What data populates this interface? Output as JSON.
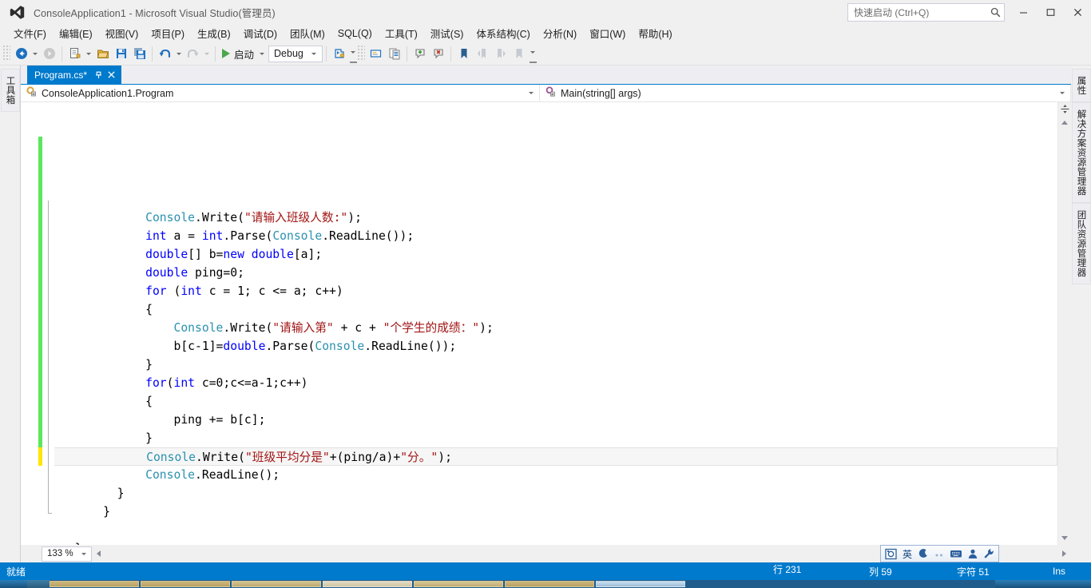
{
  "window": {
    "title": "ConsoleApplication1 - Microsoft Visual Studio(管理员)",
    "logo_icon": "visual-studio-logo-icon",
    "minimize_label": "─",
    "maximize_label": "☐",
    "close_label": "✕"
  },
  "quick_launch": {
    "placeholder": "快速启动 (Ctrl+Q)",
    "value": "",
    "icon": "search-icon"
  },
  "menubar": {
    "items": [
      {
        "text": "文件(F)",
        "name": "menu-file"
      },
      {
        "text": "编辑(E)",
        "name": "menu-edit"
      },
      {
        "text": "视图(V)",
        "name": "menu-view"
      },
      {
        "text": "项目(P)",
        "name": "menu-project"
      },
      {
        "text": "生成(B)",
        "name": "menu-build"
      },
      {
        "text": "调试(D)",
        "name": "menu-debug"
      },
      {
        "text": "团队(M)",
        "name": "menu-team"
      },
      {
        "text": "SQL(Q)",
        "name": "menu-sql"
      },
      {
        "text": "工具(T)",
        "name": "menu-tools"
      },
      {
        "text": "测试(S)",
        "name": "menu-test"
      },
      {
        "text": "体系结构(C)",
        "name": "menu-architecture"
      },
      {
        "text": "分析(N)",
        "name": "menu-analyze"
      },
      {
        "text": "窗口(W)",
        "name": "menu-window"
      },
      {
        "text": "帮助(H)",
        "name": "menu-help"
      }
    ]
  },
  "toolbar": {
    "start_label": "启动",
    "config_value": "Debug",
    "icons": [
      "navigate-backward-icon",
      "navigate-forward-icon",
      "new-project-icon",
      "open-file-icon",
      "save-icon",
      "save-all-icon",
      "undo-icon",
      "redo-icon",
      "start-debug-icon",
      "solution-platform-icon",
      "find-in-files-icon",
      "comment-icon",
      "add-breakpoint-icon",
      "delete-breakpoint-icon",
      "bookmark-icon",
      "previous-bookmark-icon",
      "next-bookmark-icon",
      "clear-bookmarks-icon"
    ]
  },
  "left_dock": {
    "tabs": [
      {
        "label": "工具箱",
        "name": "sidebar-tab-toolbox"
      }
    ]
  },
  "right_dock": {
    "tabs": [
      {
        "label": "属性",
        "name": "sidebar-tab-properties"
      },
      {
        "label": "解决方案资源管理器",
        "name": "sidebar-tab-solution-explorer"
      },
      {
        "label": "团队资源管理器",
        "name": "sidebar-tab-team-explorer"
      }
    ]
  },
  "editor": {
    "tab": {
      "label": "Program.cs*",
      "pin_icon": "pin-icon",
      "close_icon": "close-icon"
    },
    "navbar": {
      "class_icon": "class-icon",
      "class_value": "ConsoleApplication1.Program",
      "member_icon": "method-icon",
      "member_value": "Main(string[] args)"
    },
    "zoom_level": "133 %",
    "code_lines": [
      {
        "indent": 12,
        "tokens": [
          {
            "t": "Console",
            "c": "type"
          },
          {
            "t": ".Write(",
            "c": "pln"
          },
          {
            "t": "\"请输入班级人数:\"",
            "c": "str"
          },
          {
            "t": ");",
            "c": "pln"
          }
        ]
      },
      {
        "indent": 12,
        "tokens": [
          {
            "t": "int",
            "c": "kw"
          },
          {
            "t": " a = ",
            "c": "pln"
          },
          {
            "t": "int",
            "c": "kw"
          },
          {
            "t": ".Parse(",
            "c": "pln"
          },
          {
            "t": "Console",
            "c": "type"
          },
          {
            "t": ".ReadLine());",
            "c": "pln"
          }
        ]
      },
      {
        "indent": 12,
        "tokens": [
          {
            "t": "double",
            "c": "kw"
          },
          {
            "t": "[] b=",
            "c": "pln"
          },
          {
            "t": "new",
            "c": "kw"
          },
          {
            "t": " ",
            "c": "pln"
          },
          {
            "t": "double",
            "c": "kw"
          },
          {
            "t": "[a];",
            "c": "pln"
          }
        ]
      },
      {
        "indent": 12,
        "tokens": [
          {
            "t": "double",
            "c": "kw"
          },
          {
            "t": " ping=0;",
            "c": "pln"
          }
        ]
      },
      {
        "indent": 12,
        "tokens": [
          {
            "t": "for",
            "c": "kw"
          },
          {
            "t": " (",
            "c": "pln"
          },
          {
            "t": "int",
            "c": "kw"
          },
          {
            "t": " c = 1; c <= a; c++)",
            "c": "pln"
          }
        ]
      },
      {
        "indent": 12,
        "tokens": [
          {
            "t": "{",
            "c": "pln"
          }
        ]
      },
      {
        "indent": 16,
        "tokens": [
          {
            "t": "Console",
            "c": "type"
          },
          {
            "t": ".Write(",
            "c": "pln"
          },
          {
            "t": "\"请输入第\"",
            "c": "str"
          },
          {
            "t": " + c + ",
            "c": "pln"
          },
          {
            "t": "\"个学生的成绩：\"",
            "c": "str"
          },
          {
            "t": ");",
            "c": "pln"
          }
        ]
      },
      {
        "indent": 16,
        "tokens": [
          {
            "t": "b[c-1]=",
            "c": "pln"
          },
          {
            "t": "double",
            "c": "kw"
          },
          {
            "t": ".Parse(",
            "c": "pln"
          },
          {
            "t": "Console",
            "c": "type"
          },
          {
            "t": ".ReadLine());",
            "c": "pln"
          }
        ]
      },
      {
        "indent": 12,
        "tokens": [
          {
            "t": "}",
            "c": "pln"
          }
        ]
      },
      {
        "indent": 12,
        "tokens": [
          {
            "t": "for",
            "c": "kw"
          },
          {
            "t": "(",
            "c": "pln"
          },
          {
            "t": "int",
            "c": "kw"
          },
          {
            "t": " c=0;c<=a-1;c++)",
            "c": "pln"
          }
        ]
      },
      {
        "indent": 12,
        "tokens": [
          {
            "t": "{",
            "c": "pln"
          }
        ]
      },
      {
        "indent": 16,
        "tokens": [
          {
            "t": "ping += b[c];",
            "c": "pln"
          }
        ]
      },
      {
        "indent": 12,
        "tokens": [
          {
            "t": "}",
            "c": "pln"
          }
        ]
      },
      {
        "indent": 12,
        "current": true,
        "tokens": [
          {
            "t": "Console",
            "c": "type"
          },
          {
            "t": ".Write(",
            "c": "pln"
          },
          {
            "t": "\"班级平均分是\"",
            "c": "str"
          },
          {
            "t": "+(ping/a)+",
            "c": "pln"
          },
          {
            "t": "\"分。\"",
            "c": "str"
          },
          {
            "t": ");",
            "c": "pln"
          }
        ]
      },
      {
        "indent": 12,
        "tokens": [
          {
            "t": "Console",
            "c": "type"
          },
          {
            "t": ".ReadLine();",
            "c": "pln"
          }
        ]
      },
      {
        "indent": 8,
        "tokens": [
          {
            "t": "}",
            "c": "pln"
          }
        ]
      },
      {
        "indent": 6,
        "tokens": [
          {
            "t": "}",
            "c": "pln"
          }
        ]
      },
      {
        "indent": 0,
        "tokens": []
      },
      {
        "indent": 2,
        "tokens": [
          {
            "t": "}",
            "c": "pln"
          }
        ]
      }
    ]
  },
  "ime_bar": {
    "items": [
      {
        "label": "",
        "name": "ime-mode-icon"
      },
      {
        "label": "英",
        "name": "ime-english-mode-icon"
      },
      {
        "label": "",
        "name": "ime-halfwidth-icon"
      },
      {
        "label": "",
        "name": "ime-punctuation-icon"
      },
      {
        "label": "",
        "name": "ime-softkeyboard-icon"
      },
      {
        "label": "",
        "name": "ime-user-icon"
      },
      {
        "label": "",
        "name": "ime-settings-icon"
      }
    ]
  },
  "statusbar": {
    "ready": "就绪",
    "line": "行 231",
    "column": "列 59",
    "character": "字符 51",
    "insert_mode": "Ins"
  },
  "colors": {
    "accent": "#007acc",
    "keyword": "#0000ff",
    "type": "#2b91af",
    "string": "#a31515",
    "chrome": "#f0f0f0",
    "saved_change": "#5ce65c",
    "unsaved_change": "#ffe500"
  }
}
